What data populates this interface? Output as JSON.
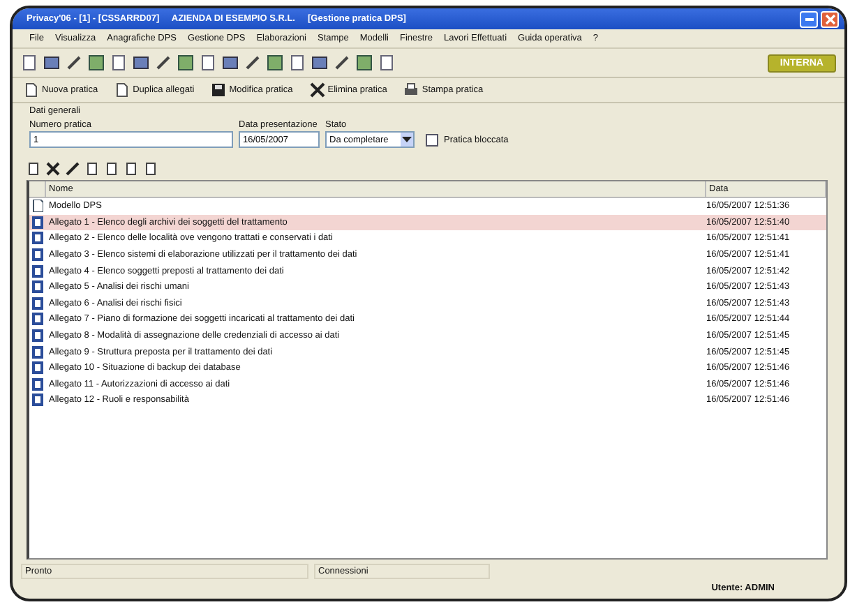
{
  "window": {
    "title": "Privacy'06 - [1] - [CSSARRD07]     AZIENDA DI ESEMPIO S.R.L.     [Gestione pratica DPS]"
  },
  "menu": [
    "File",
    "Visualizza",
    "Anagrafiche DPS",
    "Gestione DPS",
    "Elaborazioni",
    "Stampe",
    "Modelli",
    "Finestre",
    "Lavori Effettuati",
    "Guida operativa",
    "?"
  ],
  "toolbar": {
    "badge": "INTERNA"
  },
  "actions": [
    {
      "label": "Nuova pratica",
      "kind": "new"
    },
    {
      "label": "Duplica allegati",
      "kind": "copy"
    },
    {
      "label": "Modifica pratica",
      "kind": "save"
    },
    {
      "label": "Elimina pratica",
      "kind": "delete"
    },
    {
      "label": "Stampa pratica",
      "kind": "print"
    }
  ],
  "general": {
    "title": "Dati generali",
    "number_label": "Numero pratica",
    "number": "1",
    "date_label": "Data presentazione",
    "date": "16/05/2007",
    "status_label": "Stato",
    "status": "Da completare",
    "locked_label": "Pratica bloccata",
    "locked": false
  },
  "table": {
    "columns": [
      "Nome",
      "Data"
    ],
    "rows": [
      {
        "name": "Modello DPS",
        "date": "16/05/2007 12:51:36",
        "kind": "model",
        "selected": false
      },
      {
        "name": "Allegato 1 - Elenco degli archivi dei soggetti del trattamento",
        "date": "16/05/2007 12:51:40",
        "kind": "doc",
        "selected": true
      },
      {
        "name": "Allegato 2 - Elenco delle località ove vengono trattati e conservati i dati",
        "date": "16/05/2007 12:51:41",
        "kind": "doc",
        "selected": false
      },
      {
        "name": "Allegato 3 - Elenco sistemi di elaborazione utilizzati per il trattamento dei dati",
        "date": "16/05/2007 12:51:41",
        "kind": "doc",
        "selected": false
      },
      {
        "name": "Allegato 4 - Elenco soggetti preposti al trattamento dei dati",
        "date": "16/05/2007 12:51:42",
        "kind": "doc",
        "selected": false
      },
      {
        "name": "Allegato 5 - Analisi dei rischi umani",
        "date": "16/05/2007 12:51:43",
        "kind": "doc",
        "selected": false
      },
      {
        "name": "Allegato 6 - Analisi dei rischi fisici",
        "date": "16/05/2007 12:51:43",
        "kind": "doc",
        "selected": false
      },
      {
        "name": "Allegato 7 - Piano di formazione dei soggetti incaricati al trattamento dei dati",
        "date": "16/05/2007 12:51:44",
        "kind": "doc",
        "selected": false
      },
      {
        "name": "Allegato 8 - Modalità di assegnazione delle credenziali di accesso ai dati",
        "date": "16/05/2007 12:51:45",
        "kind": "doc",
        "selected": false
      },
      {
        "name": "Allegato 9 - Struttura preposta per il trattamento dei dati",
        "date": "16/05/2007 12:51:45",
        "kind": "doc",
        "selected": false
      },
      {
        "name": "Allegato 10 - Situazione di backup dei database",
        "date": "16/05/2007 12:51:46",
        "kind": "doc",
        "selected": false
      },
      {
        "name": "Allegato 11 - Autorizzazioni di accesso ai dati",
        "date": "16/05/2007 12:51:46",
        "kind": "doc",
        "selected": false
      },
      {
        "name": "Allegato 12 - Ruoli e responsabilità",
        "date": "16/05/2007 12:51:46",
        "kind": "doc",
        "selected": false
      }
    ]
  },
  "status_bar": {
    "left": "Pronto",
    "middle": "Connessioni",
    "user": "Utente: ADMIN"
  }
}
